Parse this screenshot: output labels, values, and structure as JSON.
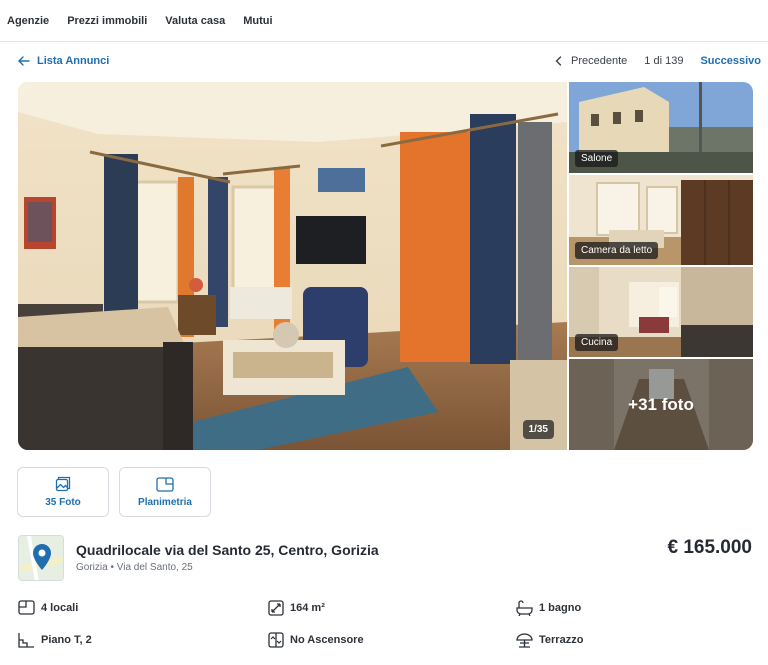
{
  "nav": {
    "items": [
      "Agenzie",
      "Prezzi immobili",
      "Valuta casa",
      "Mutui"
    ]
  },
  "subnav": {
    "back_label": "Lista Annunci",
    "prev_label": "Precedente",
    "position": "1 di 139",
    "next_label": "Successivo"
  },
  "gallery": {
    "counter": "1/35",
    "thumbs": [
      {
        "label": "Salone"
      },
      {
        "label": "Camera da letto"
      },
      {
        "label": "Cucina"
      },
      {
        "label": "+31 foto"
      }
    ]
  },
  "media_buttons": {
    "photos_label": "35 Foto",
    "plan_label": "Planimetria"
  },
  "listing": {
    "title": "Quadrilocale via del Santo 25, Centro, Gorizia",
    "address": "Gorizia • Via del Santo, 25",
    "price": "€ 165.000"
  },
  "features": {
    "rooms": "4 locali",
    "area": "164 m²",
    "bathrooms": "1 bagno",
    "floor": "Piano T, 2",
    "elevator": "No Ascensore",
    "terrace": "Terrazzo"
  },
  "colors": {
    "accent": "#1f6fb0",
    "text": "#262a33",
    "border": "#d7dbe2"
  }
}
